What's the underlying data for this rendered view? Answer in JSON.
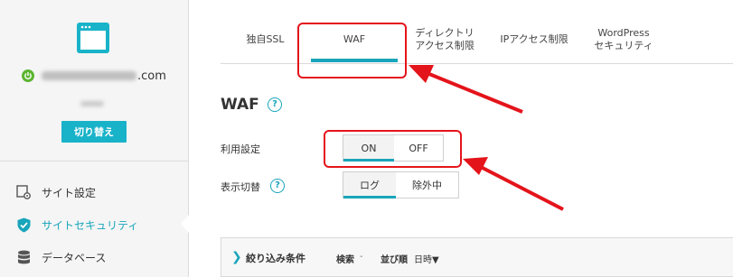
{
  "colors": {
    "accent": "#19a5bb",
    "button": "#19b3c9",
    "annotation": "#e4141b",
    "status_on": "#5cb531"
  },
  "sidebar": {
    "domain_suffix": ".com",
    "switch_button": "切り替え",
    "items": [
      {
        "label": "サイト設定",
        "icon": "site-settings-icon"
      },
      {
        "label": "サイトセキュリティ",
        "icon": "shield-check-icon",
        "active": true
      },
      {
        "label": "データベース",
        "icon": "database-icon"
      }
    ]
  },
  "tabs": [
    {
      "line1": "独自SSL",
      "line2": ""
    },
    {
      "line1": "WAF",
      "line2": "",
      "active": true
    },
    {
      "line1": "ディレクトリ",
      "line2": "アクセス制限"
    },
    {
      "line1": "IPアクセス制限",
      "line2": ""
    },
    {
      "line1": "WordPress",
      "line2": "セキュリティ"
    }
  ],
  "main": {
    "title": "WAF",
    "help": "?",
    "usage_label": "利用設定",
    "usage_on": "ON",
    "usage_off": "OFF",
    "usage_value": "ON",
    "display_label": "表示切替",
    "display_log": "ログ",
    "display_exclude": "除外中",
    "display_value": "ログ"
  },
  "filter": {
    "chevron": "❯",
    "title": "絞り込み条件",
    "search": "検索",
    "search_sep": "-",
    "order_label": "並び順",
    "order_value": "日時▼"
  }
}
